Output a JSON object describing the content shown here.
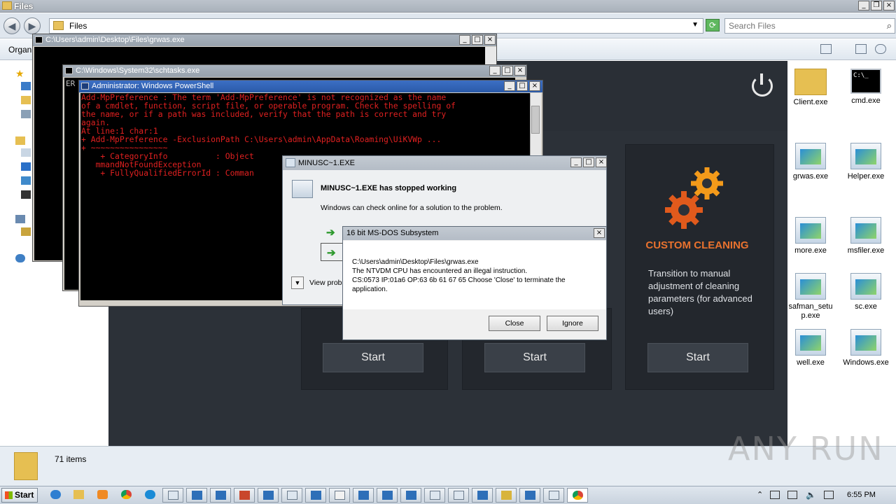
{
  "explorer": {
    "window_title": "Files",
    "breadcrumb": "Files",
    "search_placeholder": "Search Files",
    "organize_label": "Organi",
    "status_count": "71 items"
  },
  "app": {
    "card3_title": "CUSTOM CLEANING",
    "card3_desc": "Transition to manual adjustment of cleaning parameters (for advanced users)",
    "start_label": "Start",
    "accent_color": "#e9722e"
  },
  "desktop_icons": [
    {
      "label": "Client.exe",
      "icon": "folder-icon"
    },
    {
      "label": "cmd.exe",
      "icon": "console-icon"
    },
    {
      "label": "grwas.exe",
      "icon": "exe-icon"
    },
    {
      "label": "Helper.exe",
      "icon": "exe-icon"
    },
    {
      "label": "more.exe",
      "icon": "exe-icon"
    },
    {
      "label": "msfiler.exe",
      "icon": "exe-icon"
    },
    {
      "label": "safman_setu p.exe",
      "icon": "exe-icon"
    },
    {
      "label": "sc.exe",
      "icon": "exe-icon"
    },
    {
      "label": "well.exe",
      "icon": "exe-icon"
    },
    {
      "label": "Windows.exe",
      "icon": "exe-icon"
    }
  ],
  "console1": {
    "title": "C:\\Users\\admin\\Desktop\\Files\\grwas.exe"
  },
  "console2": {
    "title": "C:\\Windows\\System32\\schtasks.exe",
    "text": "ER"
  },
  "powershell": {
    "title": "Administrator: Windows PowerShell",
    "text": "Add-MpPreference : The term 'Add-MpPreference' is not recognized as the name\nof a cmdlet, function, script file, or operable program. Check the spelling of\nthe name, or if a path was included, verify that the path is correct and try\nagain.\nAt line:1 char:1\n+ Add-MpPreference -ExclusionPath C:\\Users\\admin\\AppData\\Roaming\\UiKVWp ...\n+ ~~~~~~~~~~~~~~~~\n    + CategoryInfo          : Object\n   mmandNotFoundException\n    + FullyQualifiedErrorId : Comman"
  },
  "error_dialog": {
    "title": "MINUSC~1.EXE",
    "heading": "MINUSC~1.EXE has stopped working",
    "subtext": "Windows can check online for a solution to the problem.",
    "more_label": "View prob"
  },
  "dos_dialog": {
    "title": "16 bit MS-DOS Subsystem",
    "line1": "C:\\Users\\admin\\Desktop\\Files\\grwas.exe",
    "line2": "The NTVDM CPU has encountered an illegal instruction.",
    "line3": "CS:0573 IP:01a6 OP:63 6b 61 67 65 Choose 'Close' to terminate the",
    "line4": "application.",
    "close_label": "Close",
    "ignore_label": "Ignore"
  },
  "taskbar": {
    "start_label": "Start",
    "clock": "6:55 PM"
  },
  "watermark": "ANY RUN"
}
